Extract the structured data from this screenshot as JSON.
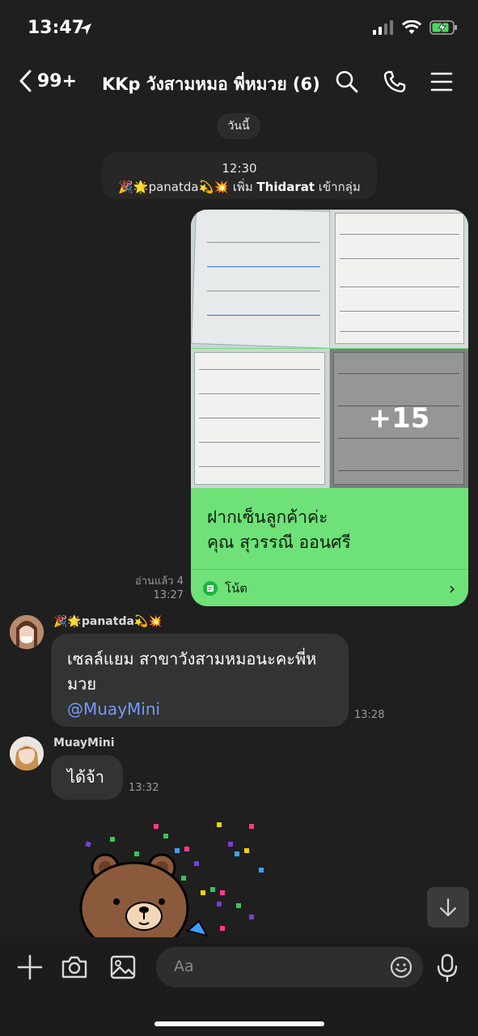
{
  "status": {
    "time": "13:47"
  },
  "header": {
    "back_count": "99+",
    "title": "KKp วังสามหมอ พี่หมวย  (6)"
  },
  "chat": {
    "date_pill": "วันนี้",
    "system": {
      "time": "12:30",
      "actor": "🎉🌟panatda💫💥",
      "action": " เพิ่ม ",
      "target": "Thidarat",
      "suffix": " เข้ากลุ่ม"
    },
    "photo_message": {
      "more_count": "+15",
      "note_line1": "ฝากเซ็นลูกค้าค่ะ",
      "note_line2": "คุณ สุวรรณี ออนศรี",
      "footer_label": "โน้ต",
      "read_status": "อ่านแล้ว 4",
      "time": "13:27"
    },
    "messages": [
      {
        "sender": "🎉🌟panatda💫💥",
        "line1": "เซลล์แยม สาขาวังสามหมอนะคะพี่ห",
        "line2": "มวย",
        "mention": "@MuayMini",
        "time": "13:28"
      },
      {
        "sender": "MuayMini",
        "text": "ได้จ้า",
        "time": "13:32"
      }
    ]
  },
  "input": {
    "placeholder": "Aa"
  },
  "colors": {
    "background": "#1f1f1f",
    "bubble_mine": "#6ee278",
    "bubble_other": "#333333",
    "mention": "#6f9cff"
  }
}
